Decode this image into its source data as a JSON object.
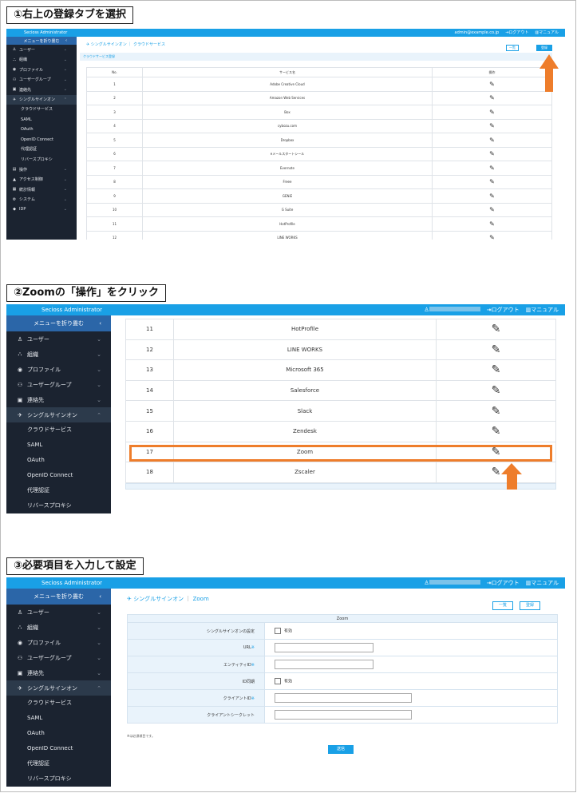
{
  "colors": {
    "accent": "#19a0e6",
    "sidebar": "#1b2330",
    "highlight": "#ee7d2b"
  },
  "app": {
    "brand": "Secioss Administrator",
    "user_email": "admin@example.co.jp",
    "logout": "ログアウト",
    "manual": "マニュアル",
    "collapse_menu": "メニューを折り畳む"
  },
  "nav": {
    "items": [
      {
        "icon": "user-icon",
        "glyph": "♙",
        "label": "ユーザー"
      },
      {
        "icon": "org-chart-icon",
        "glyph": "⛬",
        "label": "組織"
      },
      {
        "icon": "profile-icon",
        "glyph": "◉",
        "label": "プロファイル"
      },
      {
        "icon": "user-group-icon",
        "glyph": "⚇",
        "label": "ユーザーグループ"
      },
      {
        "icon": "contact-icon",
        "glyph": "▣",
        "label": "連絡先"
      },
      {
        "icon": "sso-icon",
        "glyph": "✈",
        "label": "シングルサインオン"
      }
    ],
    "sso_sub": [
      "クラウドサービス",
      "SAML",
      "OAuth",
      "OpenID Connect",
      "代理認証",
      "リバースプロキシ"
    ],
    "extra_items": [
      {
        "icon": "log-icon",
        "glyph": "▤",
        "label": "操作"
      },
      {
        "icon": "access-control-icon",
        "glyph": "▲",
        "label": "アクセス制御"
      },
      {
        "icon": "report-icon",
        "glyph": "▦",
        "label": "統計情報"
      },
      {
        "icon": "system-icon",
        "glyph": "⚙",
        "label": "システム"
      },
      {
        "icon": "tag-icon",
        "glyph": "◆",
        "label": "IDP"
      }
    ]
  },
  "step1": {
    "title": "①右上の登録タブを選択",
    "breadcrumb": "シングルサインオン ｜ クラウドサービス",
    "section_tab": "クラウドサービス登録",
    "btn_list": "一覧",
    "btn_register": "登録",
    "col_no": "No.",
    "col_service": "サービス名",
    "col_action": "操作",
    "rows": [
      {
        "no": "1",
        "name": "Adobe Creative Cloud"
      },
      {
        "no": "2",
        "name": "Amazon Web Services"
      },
      {
        "no": "3",
        "name": "Box"
      },
      {
        "no": "4",
        "name": "cybozu.com"
      },
      {
        "no": "5",
        "name": "Dropbox"
      },
      {
        "no": "6",
        "name": "eメールスタートシール"
      },
      {
        "no": "7",
        "name": "Evernote"
      },
      {
        "no": "8",
        "name": "Freee"
      },
      {
        "no": "9",
        "name": "GENiE"
      },
      {
        "no": "10",
        "name": "G Suite"
      },
      {
        "no": "11",
        "name": "HotProfile"
      },
      {
        "no": "12",
        "name": "LINE WORKS"
      }
    ]
  },
  "step2": {
    "title": "②Zoomの「操作」をクリック",
    "rows": [
      {
        "no": "11",
        "name": "HotProfile"
      },
      {
        "no": "12",
        "name": "LINE WORKS"
      },
      {
        "no": "13",
        "name": "Microsoft 365"
      },
      {
        "no": "14",
        "name": "Salesforce"
      },
      {
        "no": "15",
        "name": "Slack"
      },
      {
        "no": "16",
        "name": "Zendesk"
      },
      {
        "no": "17",
        "name": "Zoom"
      },
      {
        "no": "18",
        "name": "Zscaler"
      }
    ]
  },
  "step3": {
    "title": "③必要項目を入力して設定",
    "breadcrumb_section": "シングルサインオン",
    "breadcrumb_sep": "｜",
    "breadcrumb_page": "Zoom",
    "btn_list": "一覧",
    "btn_register": "登録",
    "form_header": "Zoom",
    "fields": [
      {
        "label": "シングルサインオンの設定",
        "required": "",
        "type": "checkbox",
        "option": "有効"
      },
      {
        "label": "URL",
        "required": "※",
        "type": "text",
        "value": ""
      },
      {
        "label": "エンティティID",
        "required": "※",
        "type": "text",
        "value": ""
      },
      {
        "label": "ID同期",
        "required": "",
        "type": "checkbox",
        "option": "有効"
      },
      {
        "label": "クライアントID",
        "required": "※",
        "type": "text_wide",
        "value": ""
      },
      {
        "label": "クライアントシークレット",
        "required": "",
        "type": "text_wide",
        "value": ""
      }
    ],
    "required_note": "※は必須項目です。",
    "submit": "送信"
  }
}
